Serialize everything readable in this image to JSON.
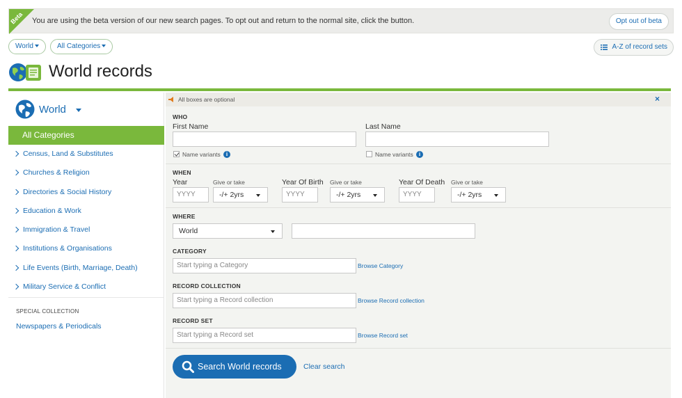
{
  "beta": {
    "ribbon": "Beta",
    "message": "You are using the beta version of our new search pages. To opt out and return to the normal site, click the button.",
    "optout_label": "Opt out of beta"
  },
  "filters": {
    "region": "World",
    "category": "All Categories",
    "az_label": "A-Z of record sets"
  },
  "page": {
    "title": "World records"
  },
  "sidebar": {
    "region": "World",
    "active": "All Categories",
    "items": [
      "Census, Land & Substitutes",
      "Churches & Religion",
      "Directories & Social History",
      "Education & Work",
      "Immigration & Travel",
      "Institutions & Organisations",
      "Life Events (Birth, Marriage, Death)",
      "Military Service & Conflict"
    ],
    "special_heading": "SPECIAL COLLECTION",
    "special_item": "Newspapers & Periodicals"
  },
  "form": {
    "optional_note": "All boxes are optional",
    "close": "×",
    "who": {
      "heading": "WHO",
      "first_name_label": "First Name",
      "first_name_value": "",
      "last_name_label": "Last Name",
      "last_name_value": "",
      "first_variants_label": "Name variants",
      "first_variants_checked": true,
      "last_variants_label": "Name variants",
      "last_variants_checked": false
    },
    "when": {
      "heading": "WHEN",
      "year_label": "Year",
      "year_placeholder": "YYYY",
      "give_or_take": "Give or take",
      "range_value": "-/+ 2yrs",
      "birth_label": "Year Of Birth",
      "birth_placeholder": "YYYY",
      "death_label": "Year Of Death",
      "death_placeholder": "YYYY"
    },
    "where": {
      "heading": "WHERE",
      "region_value": "World",
      "place_value": ""
    },
    "category": {
      "heading": "CATEGORY",
      "placeholder": "Start typing a Category",
      "browse": "Browse Category"
    },
    "collection": {
      "heading": "RECORD COLLECTION",
      "placeholder": "Start typing a Record collection",
      "browse": "Browse Record collection"
    },
    "record_set": {
      "heading": "RECORD SET",
      "placeholder": "Start typing a Record set",
      "browse": "Browse Record set"
    },
    "search_label": "Search World records",
    "clear_label": "Clear search"
  },
  "colors": {
    "accent_green": "#7ab83c",
    "link_blue": "#1b6db3",
    "panel_bg": "#f3f4f1"
  }
}
